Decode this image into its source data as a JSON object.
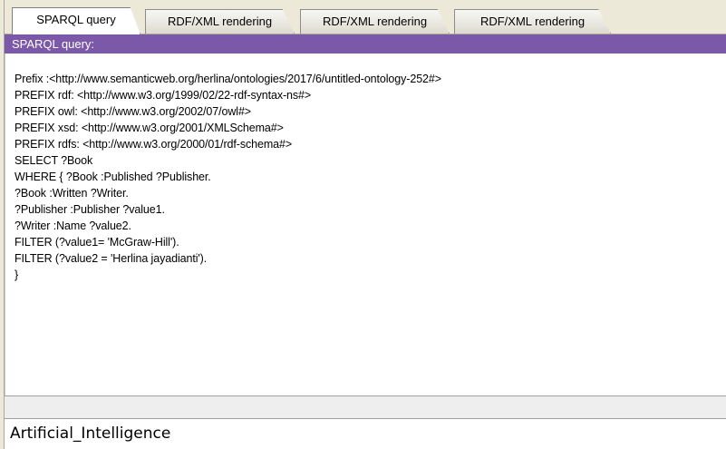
{
  "tabs": [
    {
      "label": "SPARQL query",
      "active": true
    },
    {
      "label": "RDF/XML rendering",
      "active": false
    },
    {
      "label": "RDF/XML rendering",
      "active": false
    },
    {
      "label": "RDF/XML rendering",
      "active": false
    }
  ],
  "panel": {
    "title": "SPARQL query:"
  },
  "query": {
    "lines": [
      "Prefix :<http://www.semanticweb.org/herlina/ontologies/2017/6/untitled-ontology-252#>",
      "PREFIX rdf: <http://www.w3.org/1999/02/22-rdf-syntax-ns#>",
      "PREFIX owl: <http://www.w3.org/2002/07/owl#>",
      "PREFIX xsd: <http://www.w3.org/2001/XMLSchema#>",
      "PREFIX rdfs: <http://www.w3.org/2000/01/rdf-schema#>",
      "SELECT ?Book",
      "WHERE { ?Book :Published ?Publisher.",
      "?Book :Written ?Writer.",
      "?Publisher :Publisher ?value1.",
      "?Writer :Name ?value2.",
      "FILTER (?value1= 'McGraw-Hill').",
      "FILTER (?value2 = 'Herlina jayadianti').",
      "}"
    ]
  },
  "results": {
    "header": "",
    "rows": [
      "Artificial_Intelligence"
    ]
  },
  "colors": {
    "header_bg": "#7b59a8",
    "header_text": "#ffffff",
    "tab_strip_bg": "#ece9d8"
  }
}
